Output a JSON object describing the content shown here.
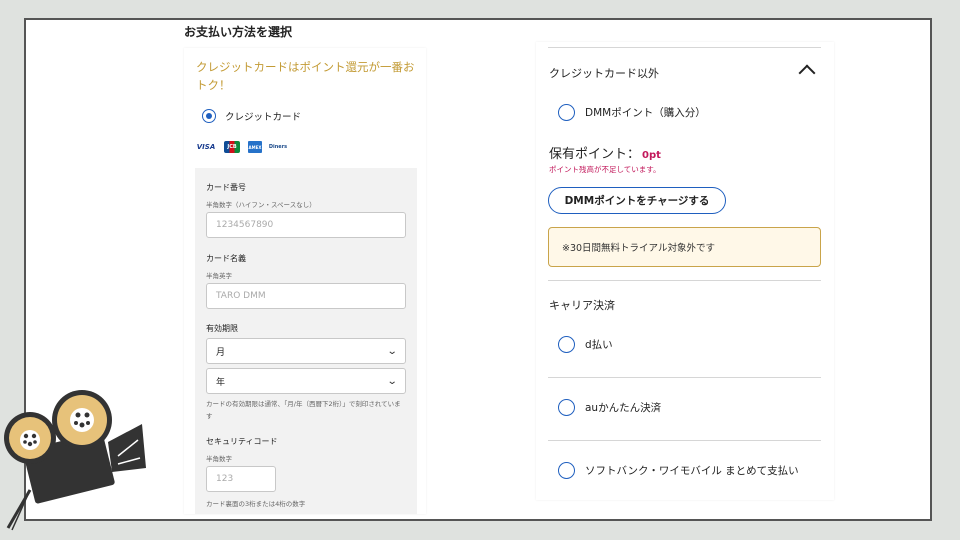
{
  "left": {
    "title": "お支払い方法を選択",
    "promo": "クレジットカードはポイント還元が一番おトク！",
    "credit_card_label": "クレジットカード",
    "brands": [
      "VISA",
      "JCB",
      "AMEX",
      "Diners"
    ],
    "card_number": {
      "label": "カード番号",
      "hint": "半角数字（ハイフン・スペースなし）",
      "placeholder": "1234567890"
    },
    "card_name": {
      "label": "カード名義",
      "hint": "半角英字",
      "placeholder": "TARO DMM"
    },
    "expiry": {
      "label": "有効期限",
      "month": "月",
      "year": "年",
      "note": "カードの有効期限は通常、「月/年（西暦下2桁）」で刻印されています"
    },
    "security": {
      "label": "セキュリティコード",
      "hint": "半角数字",
      "placeholder": "123",
      "note": "カード裏面の3桁または4桁の数字"
    }
  },
  "right": {
    "section_other": "クレジットカード以外",
    "dmm_points": "DMMポイント（購入分）",
    "held_label": "保有ポイント：",
    "held_value": "0pt",
    "warning": "ポイント残高が不足しています。",
    "charge_button": "DMMポイントをチャージする",
    "notice": "※30日間無料トライアル対象外です",
    "section_carrier": "キャリア決済",
    "options": [
      "d払い",
      "auかんたん決済",
      "ソフトバンク・ワイモバイル まとめて支払い"
    ]
  },
  "colors": {
    "accent": "#1f5fbf",
    "promo": "#c39b35",
    "warning": "#c2185b",
    "notice_bg": "#fff8e8"
  }
}
